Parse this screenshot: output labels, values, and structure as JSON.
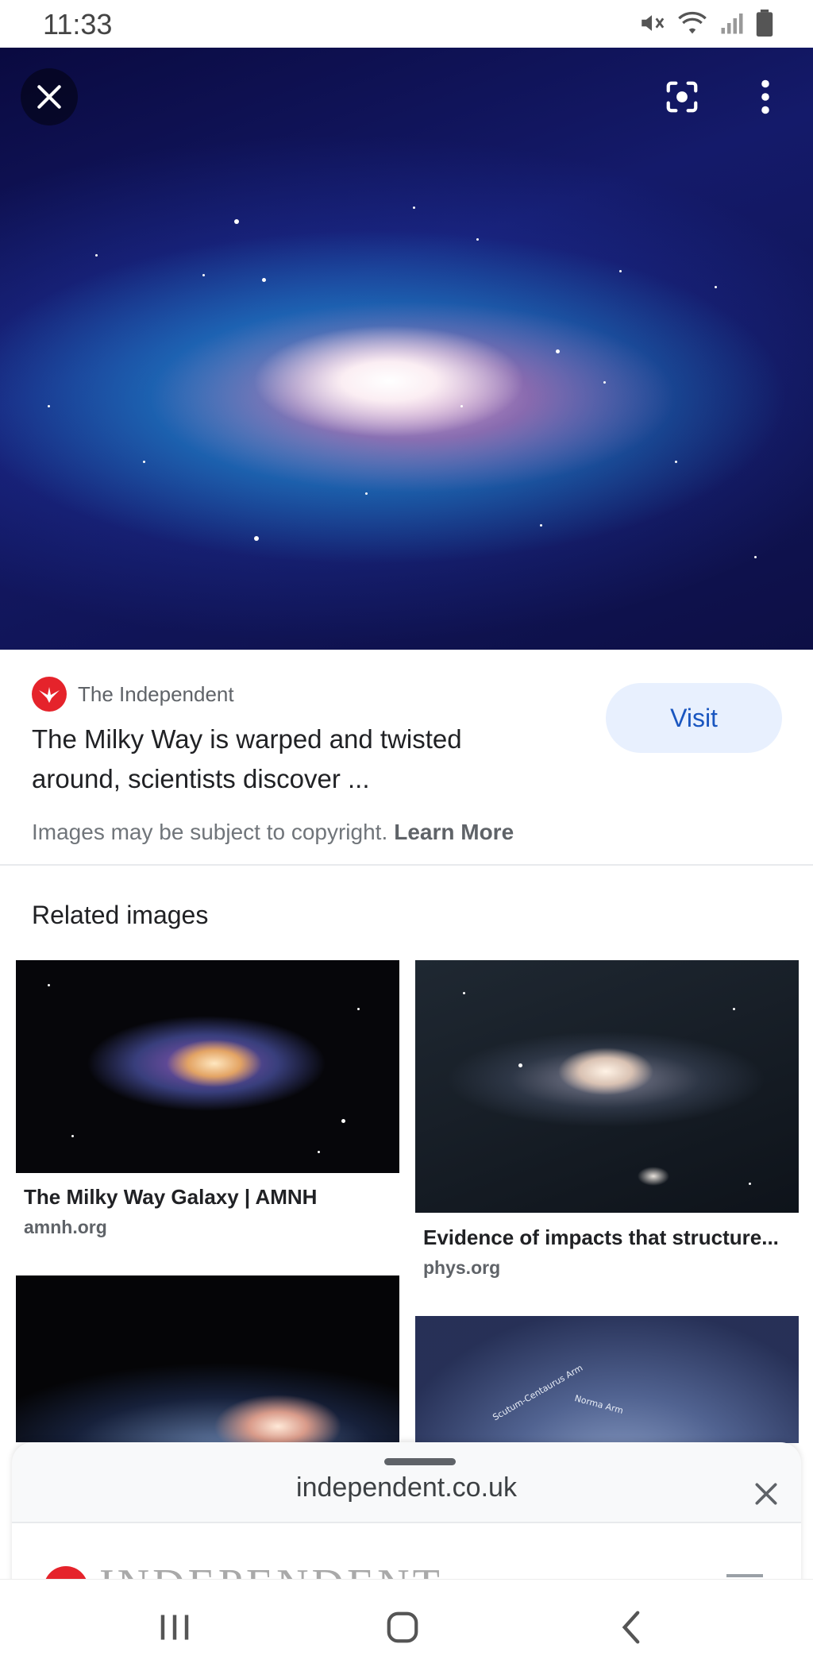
{
  "status_bar": {
    "time": "11:33",
    "icons": [
      "mute-icon",
      "wifi-icon",
      "signal-icon",
      "battery-icon"
    ]
  },
  "viewer": {
    "close_icon": "close-icon",
    "lens_icon": "lens-icon",
    "more_icon": "more-vertical-icon"
  },
  "result": {
    "source_name": "The Independent",
    "title": "The Milky Way is warped and twisted around, scientists discover ...",
    "visit_label": "Visit",
    "copyright_text": "Images may be subject to copyright.",
    "learn_more_label": "Learn More"
  },
  "related": {
    "heading": "Related images",
    "items": [
      {
        "title": "The Milky Way Galaxy | AMNH",
        "domain": "amnh.org"
      },
      {
        "title": "Evidence of impacts that structure...",
        "domain": "phys.org"
      }
    ],
    "diagram_labels": [
      "Scutum-Centaurus Arm",
      "Norma Arm"
    ]
  },
  "sheet": {
    "url": "independent.co.uk",
    "preview_brand": "INDEPENDENT"
  },
  "colors": {
    "visit_bg": "#e8f0fe",
    "visit_text": "#1a56c0",
    "brand_red": "#e5232b"
  }
}
